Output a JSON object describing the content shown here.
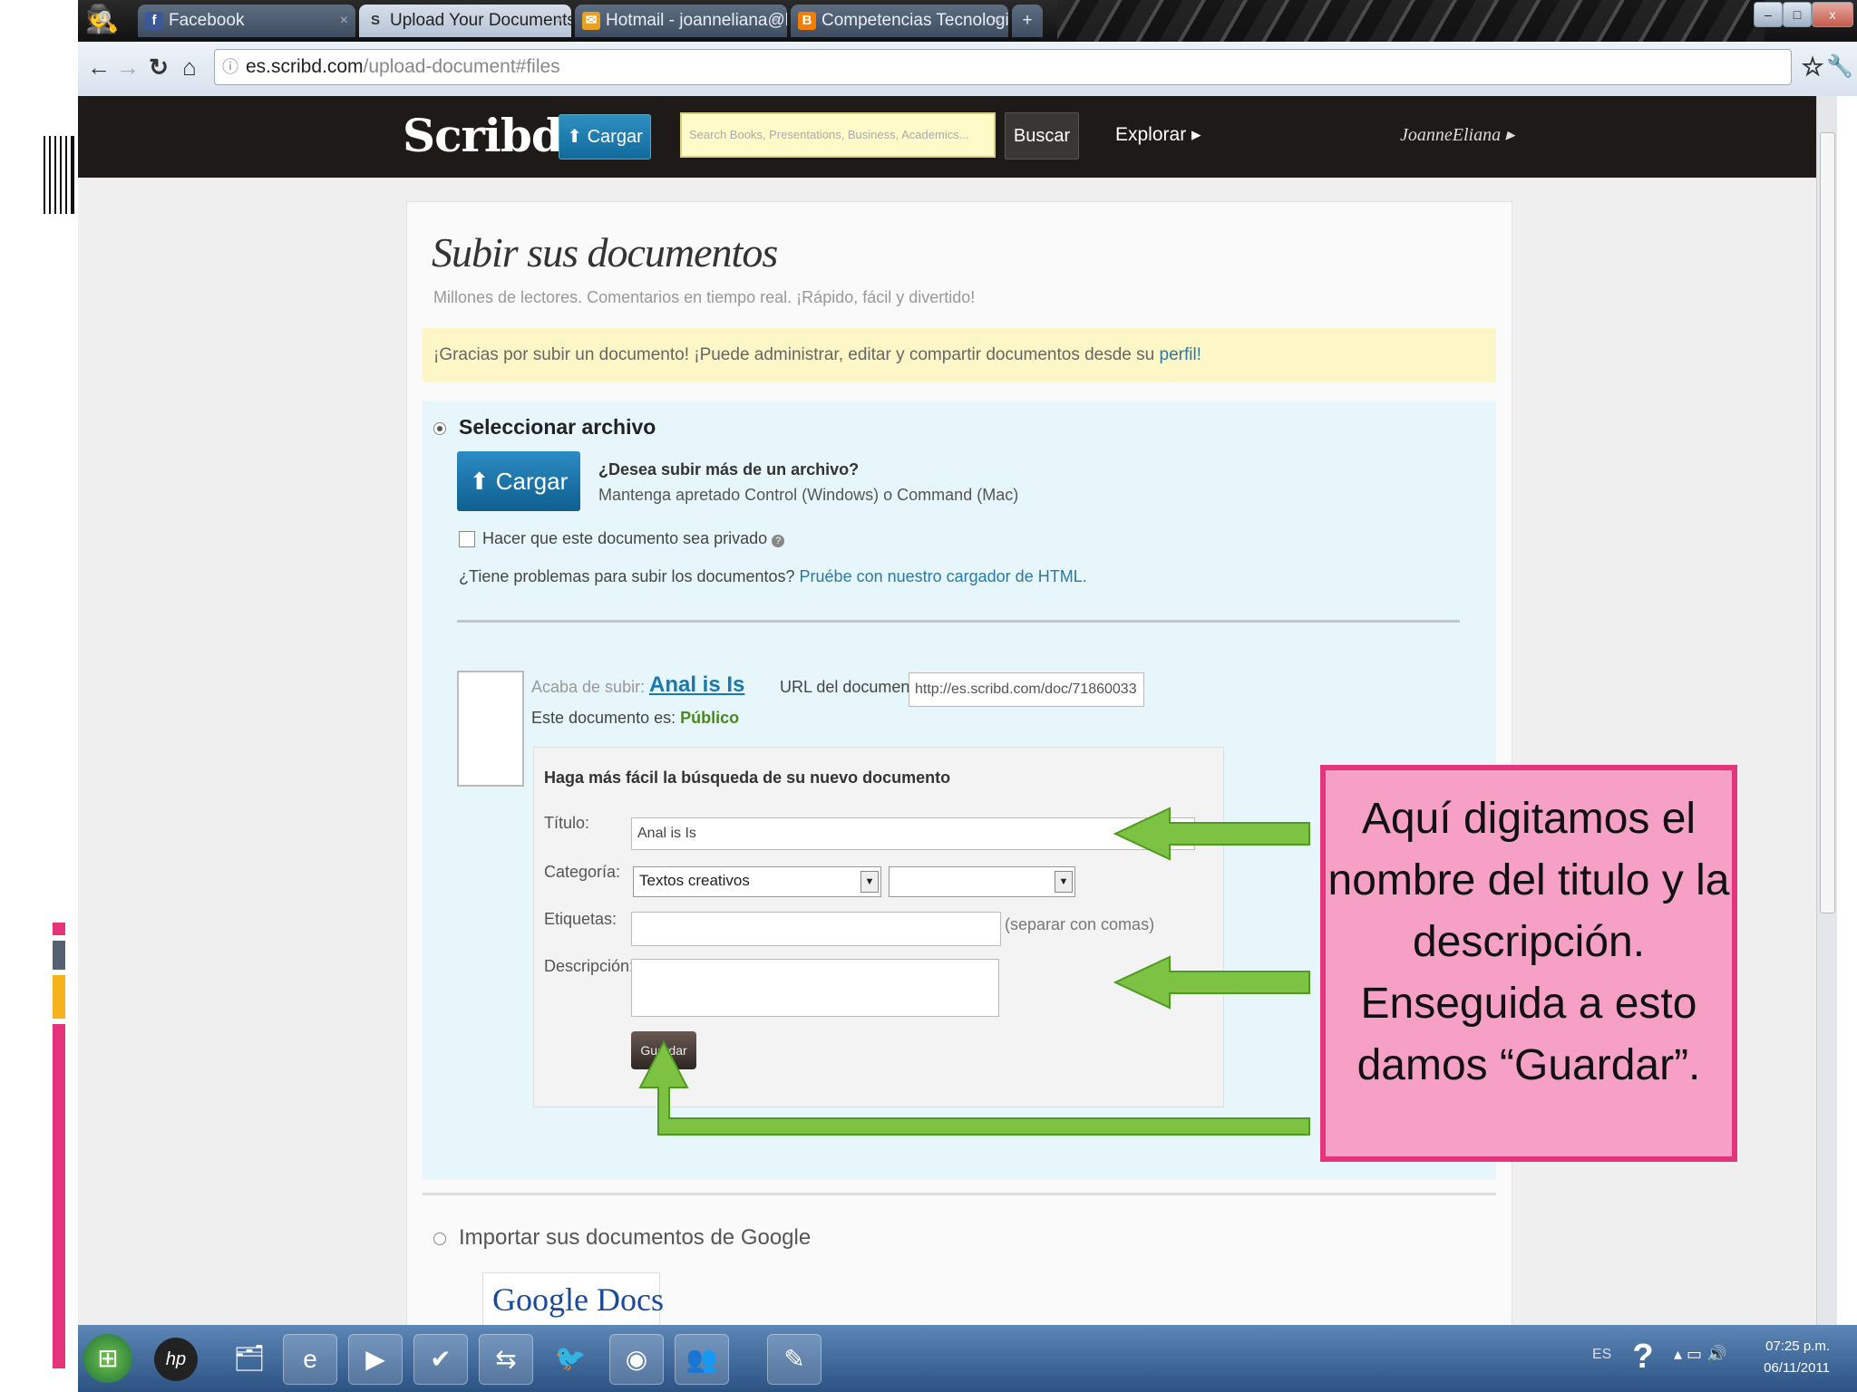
{
  "browser": {
    "tabs": [
      {
        "label": "Facebook",
        "icon": "facebook-icon",
        "icon_glyph": "f",
        "icon_color": "#3b5998"
      },
      {
        "label": "Upload Your Documents N",
        "icon": "scribd-icon",
        "icon_glyph": "S",
        "icon_color": "#555"
      },
      {
        "label": "Hotmail - joanneliana@hot",
        "icon": "hotmail-icon",
        "icon_glyph": "✉",
        "icon_color": "#e8a020"
      },
      {
        "label": "Competencias Tecnologic",
        "icon": "blogger-icon",
        "icon_glyph": "B",
        "icon_color": "#f57d00"
      }
    ],
    "url_host": "es.scribd.com",
    "url_path": "/upload-document#files"
  },
  "site": {
    "logo": "Scribd.",
    "upload_button": "Cargar",
    "search_placeholder": "Search Books, Presentations, Business, Academics...",
    "search_button": "Buscar",
    "explore": "Explorar ▸",
    "user": "JoanneEliana ▸"
  },
  "upload": {
    "title": "Subir sus documentos",
    "subtitle": "Millones de lectores. Comentarios en tiempo real. ¡Rápido, fácil y divertido!",
    "notice": "¡Gracias por subir un documento! ¡Puede administrar, editar y compartir documentos desde su ",
    "notice_link": "perfil!",
    "select_file_label": "Seleccionar archivo",
    "upload_button": "Cargar",
    "multi_question": "¿Desea subir más de un archivo?",
    "multi_hint": "Mantenga apretado Control (Windows) o Command (Mac)",
    "private_label": "Hacer que este documento sea privado",
    "private_checked": false,
    "problems_text": "¿Tiene problemas para subir los documentos? ",
    "problems_link": "Pruébe con nuestro cargador de HTML.",
    "just_uploaded_label": "Acaba de subir:",
    "just_uploaded_name": "Anal is Is",
    "url_label": "URL del documento:",
    "url_value": "http://es.scribd.com/doc/71860033",
    "status_label": "Este documento es:",
    "status_value": "Público",
    "form_heading": "Haga más fácil la búsqueda de su nuevo documento",
    "title_label": "Título:",
    "title_value": "Anal is Is",
    "category_label": "Categoría:",
    "category_value": "Textos creativos",
    "subcategory_value": "",
    "tags_label": "Etiquetas:",
    "tags_value": "",
    "tags_hint": "(separar con comas)",
    "description_label": "Descripción:",
    "description_value": "",
    "save_button": "Guardar",
    "import_label": "Importar sus documentos de Google",
    "google_docs_logo": "Google Docs"
  },
  "callout": {
    "text": "Aquí digitamos el nombre del titulo y la descripción. Enseguida a esto damos “Guardar”."
  },
  "taskbar": {
    "language": "ES",
    "time": "07:25 p.m.",
    "date": "06/11/2011",
    "apps": [
      "start-orb-icon",
      "hp-icon",
      "folder-icon",
      "internet-explorer-icon",
      "media-player-icon",
      "tasks-icon",
      "teamviewer-icon",
      "game-icon",
      "chrome-icon",
      "messenger-icon",
      "paint-icon"
    ]
  },
  "colors": {
    "accent_pink": "#e6347c",
    "callout_fill": "#f6a0c6",
    "arrow_green": "#7dc242",
    "scribd_blue": "#1a78ad"
  }
}
